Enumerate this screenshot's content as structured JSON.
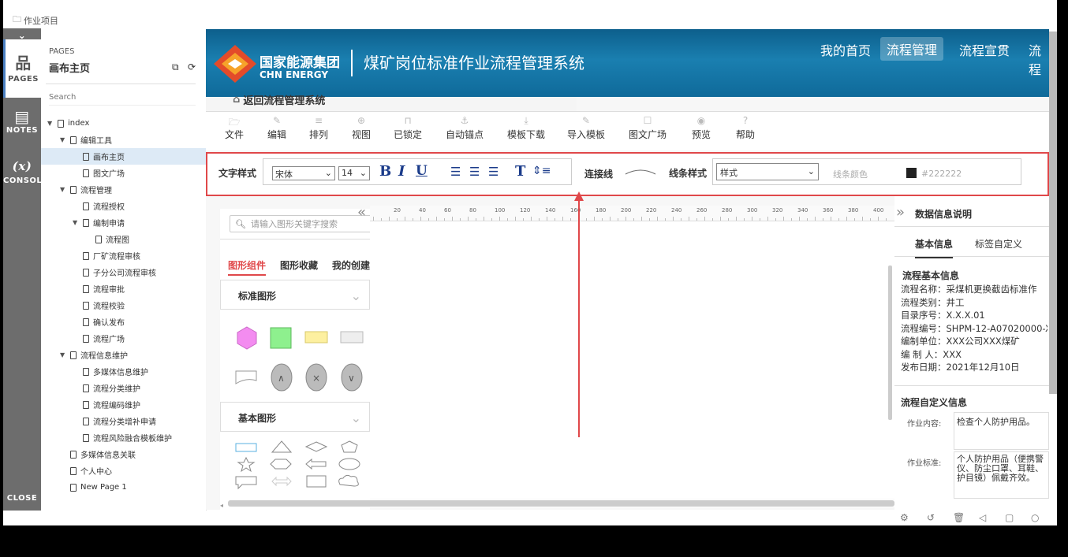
{
  "topbar": {
    "project": "作业项目"
  },
  "sidebar_tabs": {
    "pages": "PAGES",
    "notes": "NOTES",
    "console": "CONSOL",
    "x": "(x)",
    "close": "CLOSE"
  },
  "pages_panel": {
    "header": "PAGES",
    "title": "画布主页",
    "search_placeholder": "Search"
  },
  "tree": [
    {
      "label": "index",
      "level": 0,
      "caret": true
    },
    {
      "label": "编辑工具",
      "level": 1,
      "caret": true
    },
    {
      "label": "画布主页",
      "level": 2,
      "caret": false,
      "selected": true
    },
    {
      "label": "图文广场",
      "level": 2,
      "caret": false
    },
    {
      "label": "流程管理",
      "level": 1,
      "caret": true
    },
    {
      "label": "流程授权",
      "level": 2,
      "caret": false
    },
    {
      "label": "编制申请",
      "level": 2,
      "caret": true
    },
    {
      "label": "流程图",
      "level": 3,
      "caret": false
    },
    {
      "label": "厂矿流程审核",
      "level": 2,
      "caret": false
    },
    {
      "label": "子分公司流程审核",
      "level": 2,
      "caret": false
    },
    {
      "label": "流程审批",
      "level": 2,
      "caret": false
    },
    {
      "label": "流程校验",
      "level": 2,
      "caret": false
    },
    {
      "label": "确认发布",
      "level": 2,
      "caret": false
    },
    {
      "label": "流程广场",
      "level": 2,
      "caret": false
    },
    {
      "label": "流程信息维护",
      "level": 1,
      "caret": true
    },
    {
      "label": "多媒体信息维护",
      "level": 2,
      "caret": false
    },
    {
      "label": "流程分类维护",
      "level": 2,
      "caret": false
    },
    {
      "label": "流程编码维护",
      "level": 2,
      "caret": false
    },
    {
      "label": "流程分类增补申请",
      "level": 2,
      "caret": false
    },
    {
      "label": "流程风险融合模板维护",
      "level": 2,
      "caret": false
    },
    {
      "label": "多媒体信息关联",
      "level": 1,
      "caret": false
    },
    {
      "label": "个人中心",
      "level": 1,
      "caret": false
    },
    {
      "label": "New Page 1",
      "level": 1,
      "caret": false
    }
  ],
  "header": {
    "brand_cn": "国家能源集团",
    "brand_en": "CHN ENERGY",
    "system_title": "煤矿岗位标准作业流程管理系统",
    "nav": [
      "我的首页",
      "流程管理",
      "流程宣贯",
      "流程"
    ],
    "back": "返回流程管理系统"
  },
  "toolbar": [
    "文件",
    "编辑",
    "排列",
    "视图",
    "已锁定",
    "自动锚点",
    "模板下载",
    "导入模板",
    "图文广场",
    "预览",
    "帮助"
  ],
  "stylebar": {
    "text_style": "文字样式",
    "font": "宋体",
    "size": "14",
    "bold": "B",
    "italic": "I",
    "underline": "U",
    "connector": "连接线",
    "line_style": "线条样式",
    "style_select": "样式",
    "line_color": "线条颜色",
    "color_value": "#222222"
  },
  "components": {
    "search_placeholder": "请输入图形关键字搜索",
    "tabs": [
      "图形组件",
      "图形收藏",
      "我的创建"
    ],
    "group1": "标准图形",
    "group2": "基本图形"
  },
  "ruler": [
    "20",
    "40",
    "60",
    "80",
    "100",
    "120",
    "140",
    "160",
    "180",
    "200",
    "220",
    "240",
    "260",
    "280",
    "300",
    "320",
    "340",
    "360",
    "380",
    "400"
  ],
  "right": {
    "title": "数据信息说明",
    "tabs": [
      "基本信息",
      "标签自定义"
    ],
    "basic_title": "流程基本信息",
    "fields": [
      "流程名称：采煤机更换截齿标准作",
      "流程类别：井工",
      "目录序号：X.X.X.01",
      "流程编号：SHPM-12-A07020000-X",
      "编制单位：XXX公司XXX煤矿",
      "编  制  人：XXX",
      "发布日期：2021年12月10日"
    ],
    "custom_title": "流程自定义信息",
    "work_content_label": "作业内容:",
    "work_content": "检查个人防护用品。",
    "work_std_label": "作业标准:",
    "work_std": "个人防护用品（便携警仪、防尘口罩、耳鞋、护目镜）佩戴齐效。"
  },
  "colors": {
    "accent": "#e0484a",
    "header": "#1a7fb0"
  }
}
